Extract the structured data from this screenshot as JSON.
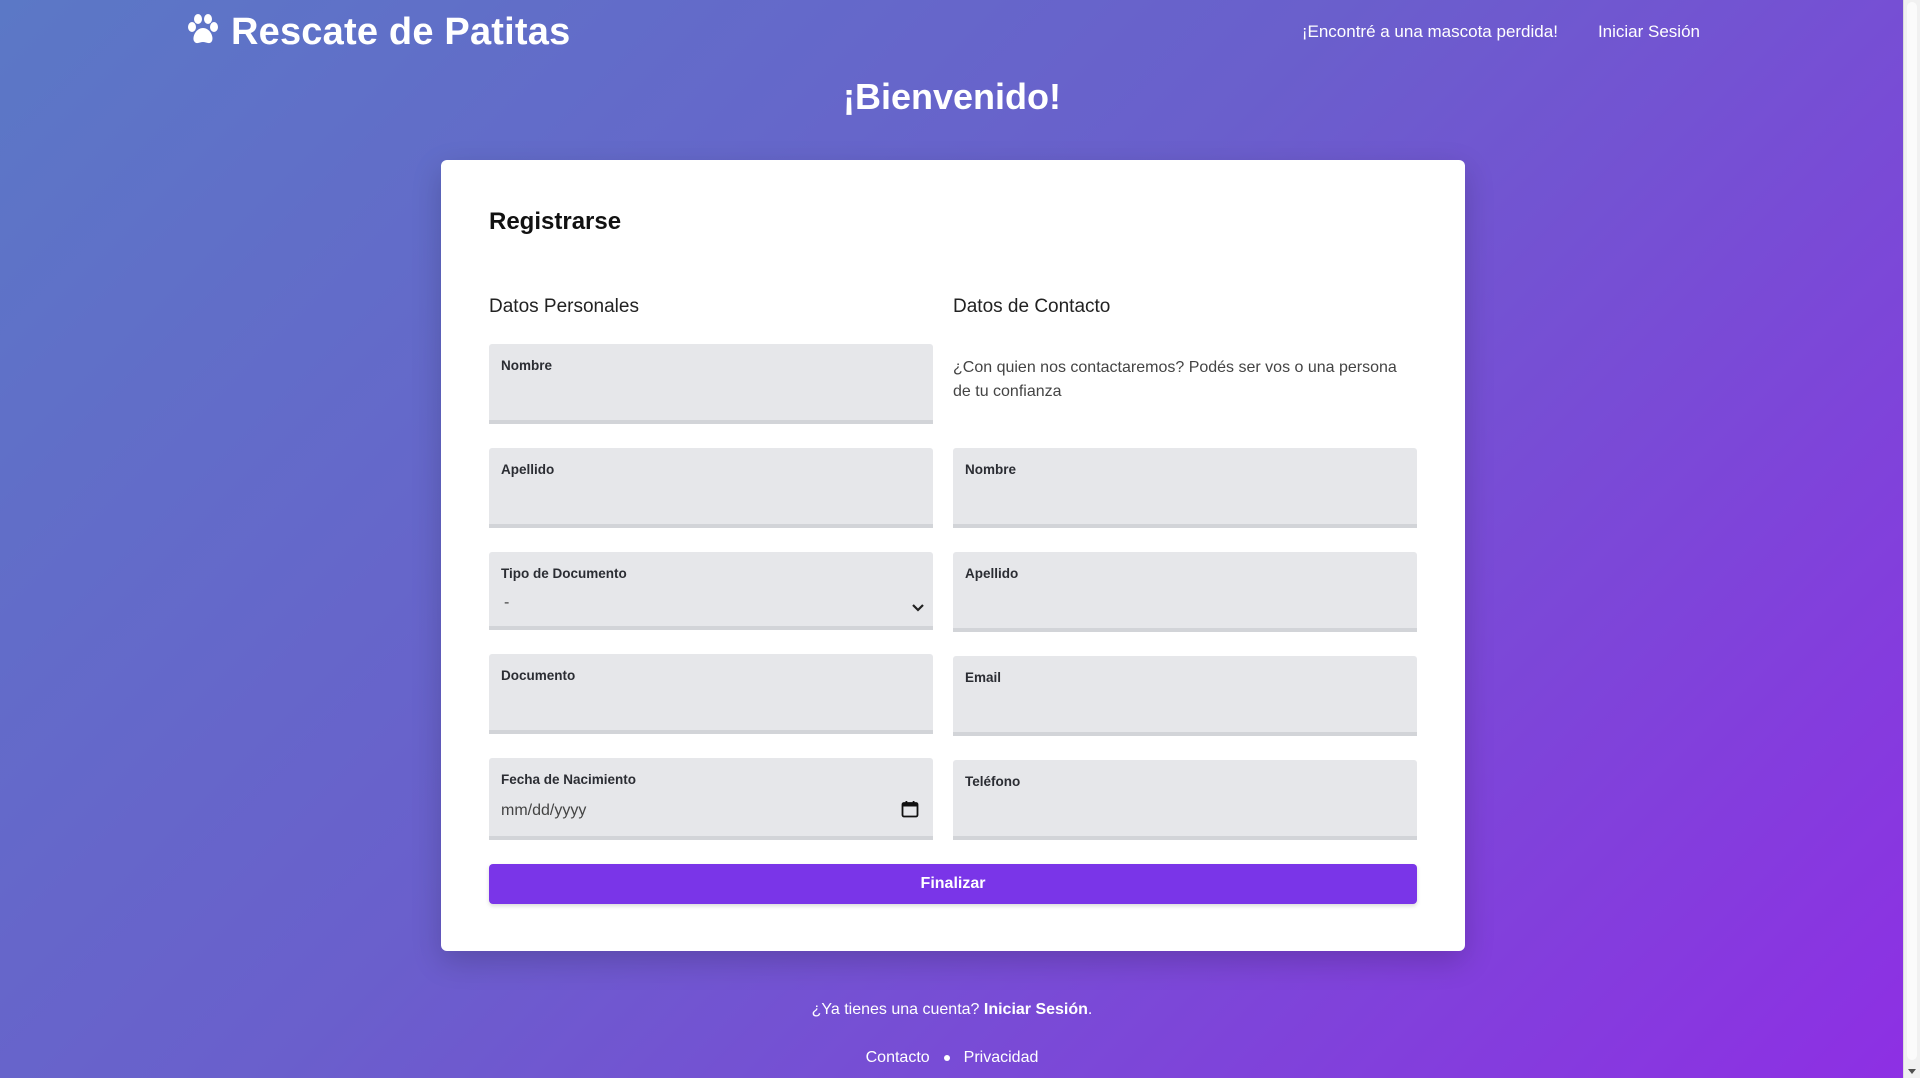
{
  "brand": {
    "name": "Rescate de Patitas",
    "logo_icon": "paw-icon"
  },
  "nav": {
    "found_pet": "¡Encontré a una mascota perdida!",
    "login": "Iniciar Sesión"
  },
  "welcome": "¡Bienvenido!",
  "form": {
    "title": "Registrarse",
    "personal": {
      "title": "Datos Personales",
      "nombre_label": "Nombre",
      "apellido_label": "Apellido",
      "tipo_doc_label": "Tipo de Documento",
      "tipo_doc_value": "-",
      "documento_label": "Documento",
      "fecha_label": "Fecha de Nacimiento",
      "fecha_placeholder": "mm/dd/yyyy"
    },
    "contact": {
      "title": "Datos de Contacto",
      "help": "¿Con quien nos contactaremos? Podés ser vos o una persona de tu confianza",
      "nombre_label": "Nombre",
      "apellido_label": "Apellido",
      "email_label": "Email",
      "telefono_label": "Teléfono"
    },
    "submit": "Finalizar"
  },
  "account": {
    "prefix": "¿Ya tienes una cuenta? ",
    "link": "Iniciar Sesión",
    "suffix": "."
  },
  "footer": {
    "contacto": "Contacto",
    "privacidad": "Privacidad"
  },
  "colors": {
    "accent": "#7a35e8",
    "field_bg": "#e6e7ea"
  }
}
